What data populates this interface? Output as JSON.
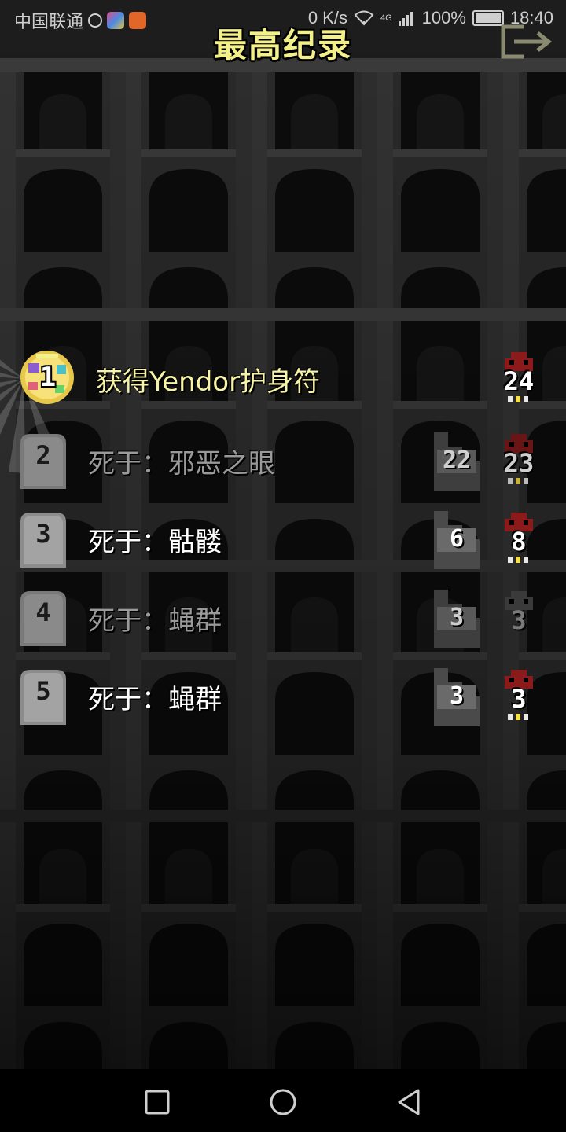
{
  "status_bar": {
    "carrier": "中国联通",
    "net_speed": "0 K/s",
    "network": "4G",
    "battery": "100%",
    "time": "18:40"
  },
  "screen": {
    "title": "最高纪录"
  },
  "records": [
    {
      "rank": "1",
      "description": "获得Yendor护身符",
      "depth": "",
      "level": "24",
      "state": "win"
    },
    {
      "rank": "2",
      "description": "死于：邪恶之眼",
      "depth": "22",
      "level": "23",
      "state": "dim"
    },
    {
      "rank": "3",
      "description": "死于：骷髅",
      "depth": "6",
      "level": "8",
      "state": "normal"
    },
    {
      "rank": "4",
      "description": "死于：蝇群",
      "depth": "3",
      "level": "3",
      "state": "dim"
    },
    {
      "rank": "5",
      "description": "死于：蝇群",
      "depth": "3",
      "level": "3",
      "state": "normal"
    }
  ],
  "colors": {
    "title": "#f3f08a",
    "win_text": "#f7f4a8",
    "dim_text": "#9a9a9a",
    "tombstone": "#9c9c9c",
    "skull_red": "#8b1a1a"
  }
}
